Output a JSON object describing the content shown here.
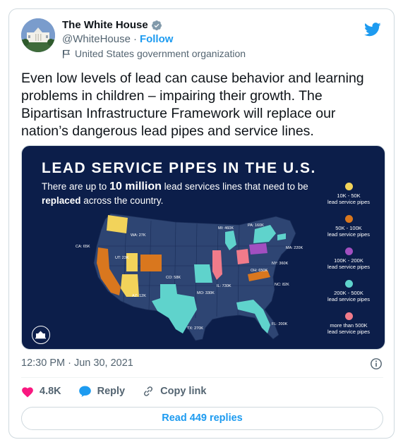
{
  "author": {
    "name": "The White House",
    "handle": "@WhiteHouse",
    "separator": "·",
    "follow_label": "Follow",
    "label": "United States government organization"
  },
  "tweet": {
    "text": "Even low levels of lead can cause behavior and learning problems in children – impairing their growth. The Bipartisan Infrastructure Framework will replace our nation’s dangerous lead pipes and service lines."
  },
  "media": {
    "title": "LEAD SERVICE PIPES IN THE U.S.",
    "subtitle_pre": "There are up to ",
    "subtitle_highlight": "10 million",
    "subtitle_mid": " lead services lines that need to be ",
    "subtitle_bold": "replaced",
    "subtitle_post": " across the country.",
    "legend": [
      {
        "range": "10K - 50K",
        "unit": "lead service pipes",
        "color": "#f2d35a"
      },
      {
        "range": "50K - 100K",
        "unit": "lead service pipes",
        "color": "#d9771e"
      },
      {
        "range": "100K - 200K",
        "unit": "lead service pipes",
        "color": "#a24fc0"
      },
      {
        "range": "200K - 500K",
        "unit": "lead service pipes",
        "color": "#5fd3cc"
      },
      {
        "range": "more than 500K",
        "unit": "lead service pipes",
        "color": "#f07b8a"
      }
    ],
    "states": [
      {
        "label": "WA: 27K",
        "category": "10K - 50K"
      },
      {
        "label": "CA: 65K",
        "category": "50K - 100K"
      },
      {
        "label": "UT: 23K",
        "category": "10K - 50K"
      },
      {
        "label": "AZ: 12K",
        "category": "10K - 50K"
      },
      {
        "label": "CO: 58K",
        "category": "50K - 100K"
      },
      {
        "label": "TX: 270K",
        "category": "200K - 500K"
      },
      {
        "label": "MO: 330K",
        "category": "200K - 500K"
      },
      {
        "label": "IL: 730K",
        "category": "more than 500K"
      },
      {
        "label": "MI: 460K",
        "category": "200K - 500K"
      },
      {
        "label": "OH: 650K",
        "category": "more than 500K"
      },
      {
        "label": "NY: 360K",
        "category": "200K - 500K"
      },
      {
        "label": "PA: 160K",
        "category": "100K - 200K"
      },
      {
        "label": "MA: 220K",
        "category": "200K - 500K"
      },
      {
        "label": "NC: 82K",
        "category": "50K - 100K"
      },
      {
        "label": "FL: 200K",
        "category": "200K - 500K"
      }
    ]
  },
  "meta": {
    "time": "12:30 PM",
    "separator": "·",
    "date": "Jun 30, 2021"
  },
  "actions": {
    "likes": "4.8K",
    "reply_label": "Reply",
    "copy_link_label": "Copy link"
  },
  "read_replies_label": "Read 449 replies",
  "colors": {
    "twitter_blue": "#1d9bf0",
    "like_pink": "#f91880",
    "map_background": "#0c1e4a",
    "state_default": "#2e4573"
  },
  "icons": [
    "verified-badge-icon",
    "twitter-bird-icon",
    "flag-icon",
    "info-icon",
    "heart-icon",
    "reply-icon",
    "link-icon"
  ]
}
